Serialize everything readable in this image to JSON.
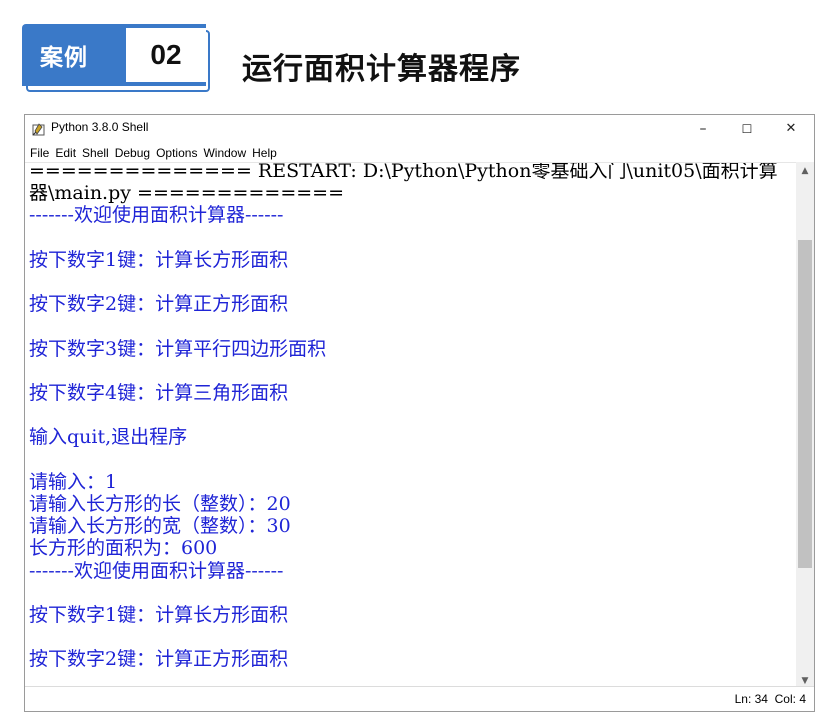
{
  "case_header": {
    "label": "案例",
    "number": "02",
    "title": "运行面积计算器程序",
    "accent_color": "#3a79c8"
  },
  "window": {
    "title": "Python 3.8.0 Shell",
    "icon": "python-shell-icon",
    "controls": {
      "minimize": "–",
      "maximize": "☐",
      "close": "✕"
    },
    "menu": [
      "File",
      "Edit",
      "Shell",
      "Debug",
      "Options",
      "Window",
      "Help"
    ]
  },
  "shell": {
    "output_color": "#1f24d6",
    "lines": [
      {
        "text": "============== RESTART: D:\\Python\\Python零基础入门\\unit05\\面积计算",
        "color": "black"
      },
      {
        "text": "器\\main.py =============",
        "color": "black"
      },
      {
        "text": "-------欢迎使用面积计算器------",
        "color": "blue"
      },
      {
        "text": "",
        "color": "blue"
      },
      {
        "text": "按下数字1键：计算长方形面积",
        "color": "blue"
      },
      {
        "text": "",
        "color": "blue"
      },
      {
        "text": "按下数字2键：计算正方形面积",
        "color": "blue"
      },
      {
        "text": "",
        "color": "blue"
      },
      {
        "text": "按下数字3键：计算平行四边形面积",
        "color": "blue"
      },
      {
        "text": "",
        "color": "blue"
      },
      {
        "text": "按下数字4键：计算三角形面积",
        "color": "blue"
      },
      {
        "text": "",
        "color": "blue"
      },
      {
        "text": "输入quit,退出程序",
        "color": "blue"
      },
      {
        "text": "",
        "color": "blue"
      },
      {
        "text": "请输入：1",
        "color": "blue"
      },
      {
        "text": "请输入长方形的长（整数）：20",
        "color": "blue"
      },
      {
        "text": "请输入长方形的宽（整数）：30",
        "color": "blue"
      },
      {
        "text": "长方形的面积为：600",
        "color": "blue"
      },
      {
        "text": "-------欢迎使用面积计算器------",
        "color": "blue"
      },
      {
        "text": "",
        "color": "blue"
      },
      {
        "text": "按下数字1键：计算长方形面积",
        "color": "blue"
      },
      {
        "text": "",
        "color": "blue"
      },
      {
        "text": "按下数字2键：计算正方形面积",
        "color": "blue"
      }
    ]
  },
  "scrollbar": {
    "up_arrow": "▲",
    "down_arrow": "▼"
  },
  "status": {
    "position": "Ln: 34  Col: 4"
  }
}
